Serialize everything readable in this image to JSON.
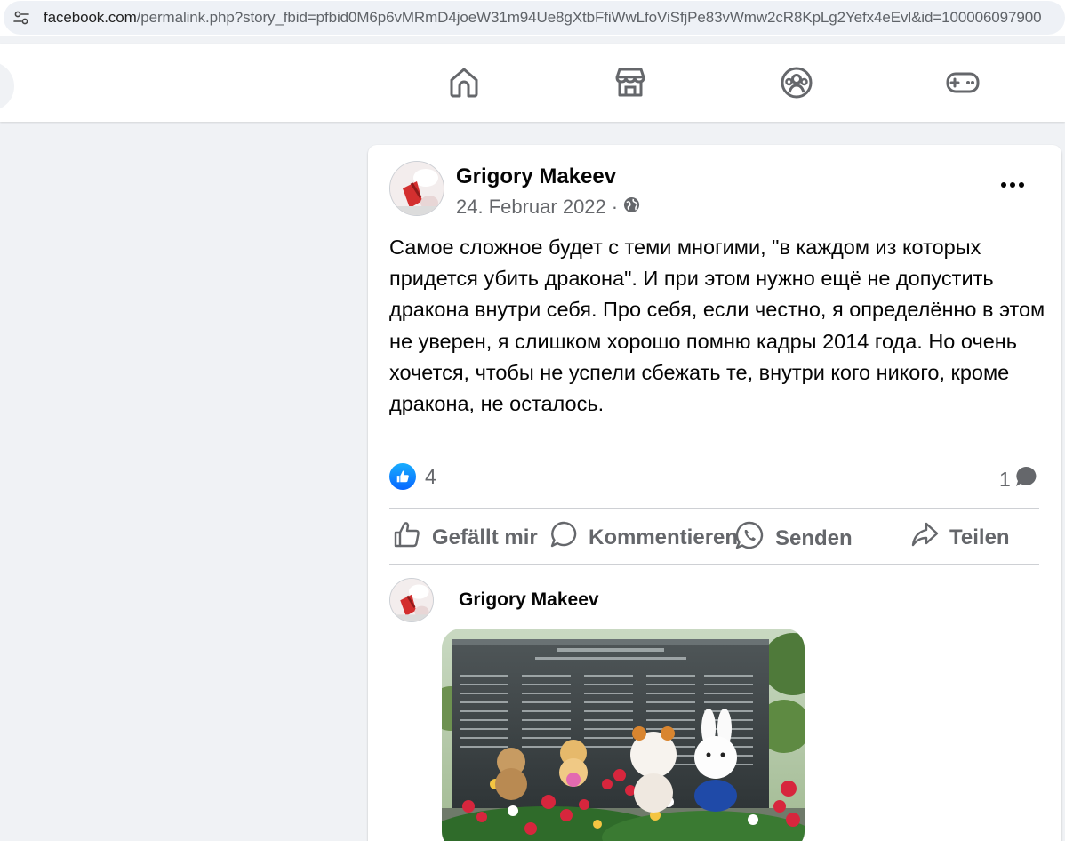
{
  "browser": {
    "url_host": "facebook.com",
    "url_rest": "/permalink.php?story_fbid=pfbid0M6p6vMRmD4joeW31m94Ue8gXtbFfiWwLfoViSfjPe83vWmw2cR8KpLg2Yefx4eEvl&id=100006097900"
  },
  "nav": {
    "icons": [
      "home-icon",
      "marketplace-icon",
      "groups-icon",
      "gaming-icon"
    ]
  },
  "post": {
    "author": "Grigory Makeev",
    "date": "24. Februar 2022",
    "separator": "·",
    "privacy_icon": "globe-icon",
    "text": "Самое сложное будет с теми многими, \"в каждом из которых придется убить дракона\". И при этом нужно ещё не допустить дракона внутри себя. Про себя, если честно, я определённо в этом не уверен, я слишком хорошо помню кадры 2014 года. Но очень хочется, чтобы не успели сбежать те, внутри кого никого, кроме дракона, не осталось.",
    "reaction_count": "4",
    "comment_count": "1",
    "more_label": "•••"
  },
  "actions": {
    "like": "Gefällt mir",
    "comment": "Kommentieren",
    "send": "Senden",
    "share": "Teilen"
  },
  "comment": {
    "author": "Grigory Makeev"
  },
  "colors": {
    "fb_blue": "#0866ff",
    "secondary_text": "#65676b",
    "background": "#f0f2f5"
  }
}
